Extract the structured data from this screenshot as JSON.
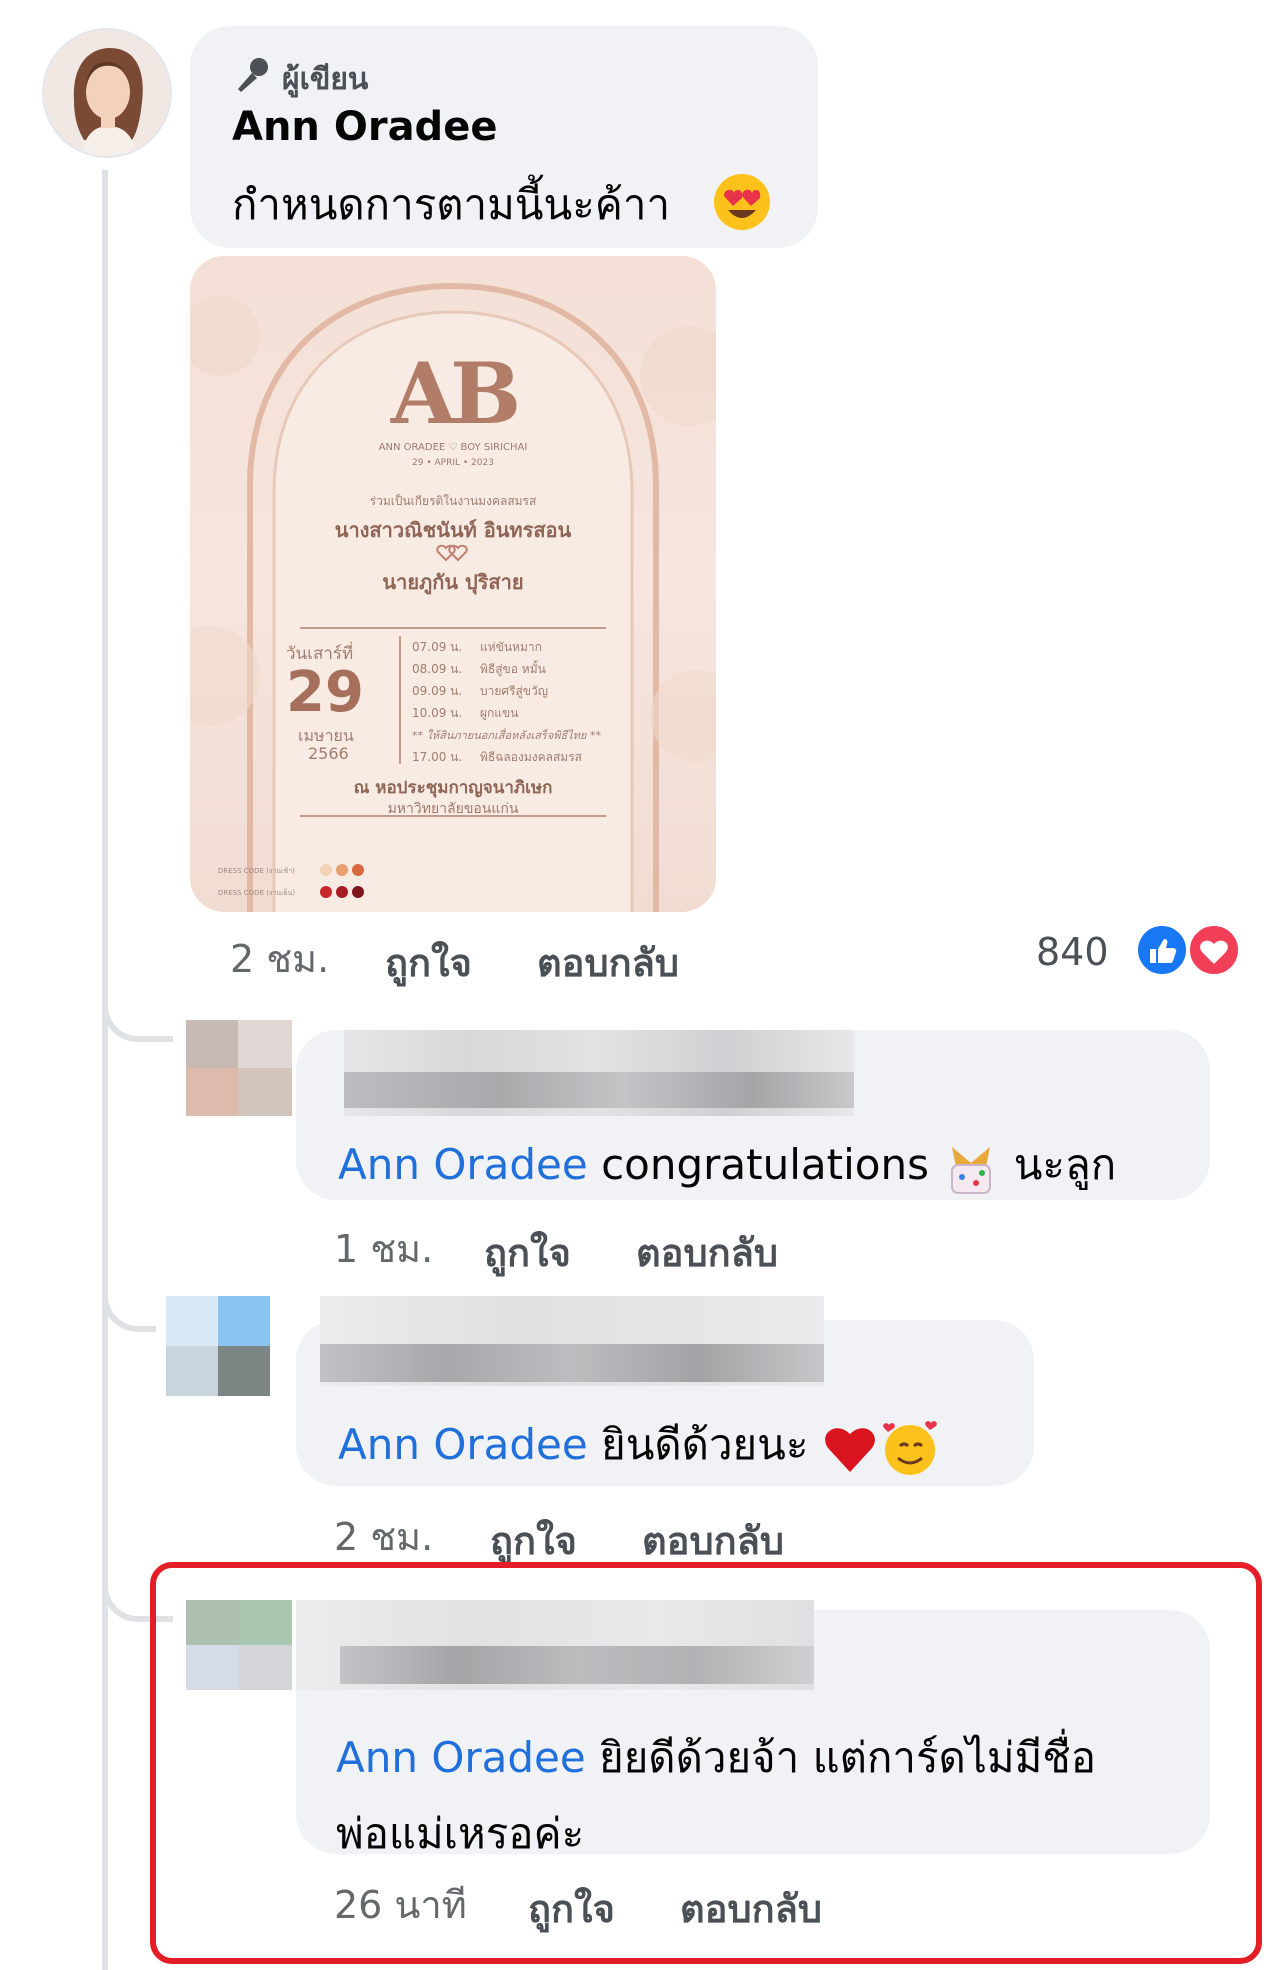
{
  "main_comment": {
    "badge_label": "ผู้เขียน",
    "author": "Ann Oradee",
    "text": "กำหนดการตามนี้นะค้าา",
    "emoji_icon": "heart-eyes-emoji",
    "time": "2 ชม.",
    "like_label": "ถูกใจ",
    "reply_label": "ตอบกลับ",
    "reaction_count": "840",
    "reactions": [
      "like",
      "love"
    ]
  },
  "invitation_card": {
    "monogram": "AB",
    "couple_line": "ANN ORADEE ♡ BOY SIRICHAI",
    "date_small": "29 • APRIL • 2023",
    "intro": "ร่วมเป็นเกียรติในงานมงคลสมรส",
    "bride": "นางสาวณิชนันท์ อินทรสอน",
    "groom": "นายภูกัน ปุริสาย",
    "weekday": "วันเสาร์ที่",
    "day": "29",
    "month": "เมษายน",
    "year": "2566",
    "schedule": [
      {
        "time": "07.09 น.",
        "event": "แห่ขันหมาก"
      },
      {
        "time": "08.09 น.",
        "event": "พิธีสู่ขอ หมั้น"
      },
      {
        "time": "09.09 น.",
        "event": "บายศรีสู่ขวัญ"
      },
      {
        "time": "10.09 น.",
        "event": "ผูกแขน"
      },
      {
        "time": "",
        "event": "** ให้สินภายนอกเสื่อหลังเสร็จพิธีไทย **"
      },
      {
        "time": "17.00 น.",
        "event": "พิธีฉลองมงคลสมรส"
      }
    ],
    "venue": "ณ หอประชุมกาญจนาภิเษก",
    "university": "มหาวิทยาลัยขอนแก่น",
    "dress_code_1": "DRESS CODE (งานเช้า)",
    "dress_code_2": "DRESS CODE (งานเย็น)"
  },
  "replies": [
    {
      "mention": "Ann Oradee",
      "text": " congratulations",
      "text_after": " นะลูก",
      "emoji_icon": "party-popper-emoji",
      "time": "1 ชม.",
      "like_label": "ถูกใจ",
      "reply_label": "ตอบกลับ"
    },
    {
      "mention": "Ann Oradee",
      "text": " ยินดีด้วยนะ",
      "emoji_icon": "red-heart-and-smiling-hearts-emoji",
      "time": "2 ชม.",
      "like_label": "ถูกใจ",
      "reply_label": "ตอบกลับ"
    },
    {
      "mention": "Ann Oradee",
      "text": " ยิยดีด้วยจ้า แต่การ์ดไม่มีชื่อ",
      "text_line2": "พ่อแม่เหรอค่ะ",
      "time": "26 นาที",
      "like_label": "ถูกใจ",
      "reply_label": "ตอบกลับ"
    }
  ],
  "colors": {
    "bubble": "#f0f2f5",
    "mention": "#216fdb",
    "meta": "#65676b",
    "highlight": "#e41e26"
  }
}
